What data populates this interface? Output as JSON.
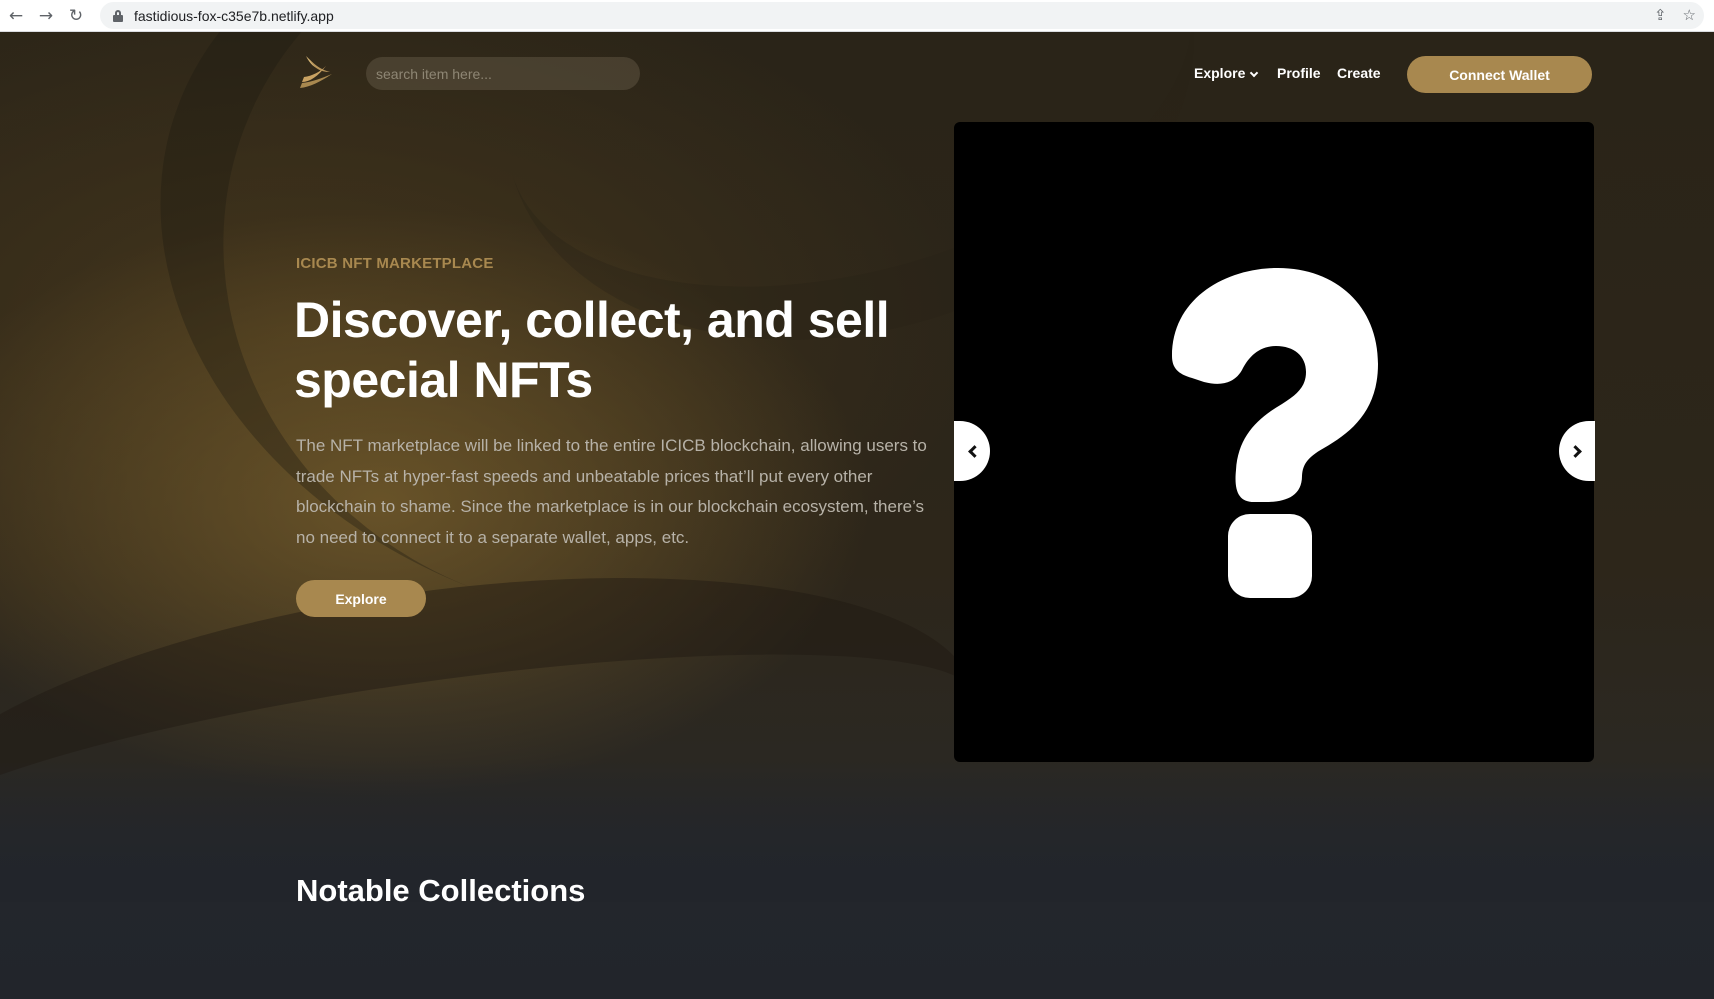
{
  "browser": {
    "url": "fastidious-fox-c35e7b.netlify.app",
    "back_icon": "←",
    "forward_icon": "→",
    "reload_icon": "↻",
    "share_icon": "⇪",
    "star_icon": "☆"
  },
  "header": {
    "search_placeholder": "search item here...",
    "nav": {
      "explore": "Explore",
      "profile": "Profile",
      "create": "Create"
    },
    "connect_wallet": "Connect Wallet"
  },
  "hero": {
    "eyebrow": "ICICB NFT MARKETPLACE",
    "headline": "Discover, collect, and sell special NFTs",
    "description": "The NFT marketplace will be linked to the entire ICICB blockchain, allowing users to trade NFTs at hyper-fast speeds and unbeatable prices that’ll put every other blockchain to shame. Since the marketplace is in our blockchain ecosystem, there’s no need to connect it to a separate wallet, apps, etc.",
    "explore_button": "Explore"
  },
  "sections": {
    "notable_collections": "Notable Collections"
  },
  "colors": {
    "accent_gold": "#a8884f",
    "page_background": "#22252b"
  }
}
